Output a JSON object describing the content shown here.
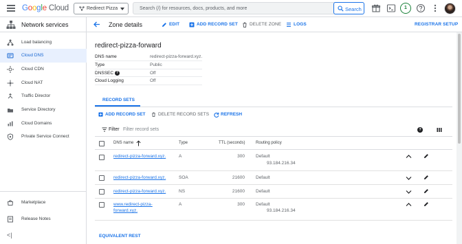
{
  "topbar": {
    "logo_letters": [
      "G",
      "o",
      "o",
      "g",
      "l",
      "e"
    ],
    "logo_product": "Cloud",
    "project": "Redirect Pizza",
    "search_placeholder": "Search (/) for resources, docs, products, and more",
    "search_button": "Search",
    "notifications_count": "1"
  },
  "sidebar": {
    "title": "Network services",
    "items": [
      {
        "label": "Load balancing",
        "icon": "load-balancing-icon"
      },
      {
        "label": "Cloud DNS",
        "icon": "cloud-dns-icon",
        "active": true
      },
      {
        "label": "Cloud CDN",
        "icon": "cloud-cdn-icon"
      },
      {
        "label": "Cloud NAT",
        "icon": "cloud-nat-icon"
      },
      {
        "label": "Traffic Director",
        "icon": "traffic-director-icon"
      },
      {
        "label": "Service Directory",
        "icon": "service-directory-icon"
      },
      {
        "label": "Cloud Domains",
        "icon": "cloud-domains-icon"
      },
      {
        "label": "Private Service Connect",
        "icon": "private-service-connect-icon"
      }
    ],
    "footer_items": [
      {
        "label": "Marketplace",
        "icon": "marketplace-icon"
      },
      {
        "label": "Release Notes",
        "icon": "release-notes-icon"
      }
    ],
    "collapse_label": "<|"
  },
  "header": {
    "title": "Zone details",
    "edit": "EDIT",
    "add_record_set": "ADD RECORD SET",
    "delete_zone": "DELETE ZONE",
    "logs": "LOGS",
    "registrar_setup": "REGISTRAR SETUP"
  },
  "zone": {
    "name": "redirect-pizza-forward",
    "details": [
      {
        "key": "DNS name",
        "value": "redirect-pizza-forward.xyz."
      },
      {
        "key": "Type",
        "value": "Public"
      },
      {
        "key": "DNSSEC",
        "value": "Off",
        "help": "?"
      },
      {
        "key": "Cloud Logging",
        "value": "Off"
      }
    ]
  },
  "record_sets": {
    "tab_label": "RECORD SETS",
    "add_label": "ADD RECORD SET",
    "delete_label": "DELETE RECORD SETS",
    "refresh_label": "REFRESH",
    "filter_label": "Filter",
    "filter_placeholder": "Filter record sets",
    "help": "?",
    "columns": [
      "DNS name",
      "Type",
      "TTL (seconds)",
      "Routing policy"
    ],
    "rows": [
      {
        "dns_name_line1": "redirect-pizza-forward.xyz.",
        "dns_name_line2": "",
        "type": "A",
        "ttl": "300",
        "policy": "Default",
        "policy_detail": "93.184.216.34",
        "expanded": true
      },
      {
        "dns_name_line1": "redirect-pizza-forward.xyz.",
        "dns_name_line2": "",
        "type": "SOA",
        "ttl": "21600",
        "policy": "Default",
        "policy_detail": "",
        "expanded": false
      },
      {
        "dns_name_line1": "redirect-pizza-forward.xyz.",
        "dns_name_line2": "",
        "type": "NS",
        "ttl": "21600",
        "policy": "Default",
        "policy_detail": "",
        "expanded": false
      },
      {
        "dns_name_line1": "www.redirect-pizza-",
        "dns_name_line2": "forward.xyz.",
        "type": "A",
        "ttl": "300",
        "policy": "Default",
        "policy_detail": "93.184.216.34",
        "expanded": true
      }
    ]
  },
  "footer": {
    "equivalent_rest": "EQUIVALENT REST"
  },
  "colors": {
    "accent": "#1a73e8",
    "active_bg": "#e8f0fe",
    "border": "#dadce0"
  }
}
